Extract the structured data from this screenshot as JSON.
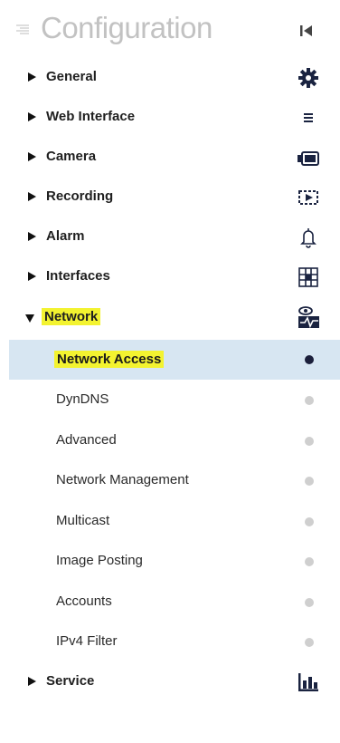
{
  "header": {
    "title": "Configuration",
    "menu_icon": "menu-lines-icon",
    "collapse_icon": "collapse-left-icon"
  },
  "nav": {
    "items": [
      {
        "label": "General",
        "icon": "gear-icon"
      },
      {
        "label": "Web Interface",
        "icon": "hamburger-icon"
      },
      {
        "label": "Camera",
        "icon": "camera-icon"
      },
      {
        "label": "Recording",
        "icon": "recording-icon"
      },
      {
        "label": "Alarm",
        "icon": "bell-icon"
      },
      {
        "label": "Interfaces",
        "icon": "interfaces-icon"
      },
      {
        "label": "Network",
        "icon": "network-monitor-icon",
        "expanded": true
      },
      {
        "label": "Service",
        "icon": "bar-chart-icon"
      }
    ],
    "network_subitems": [
      {
        "label": "Network Access",
        "active": true
      },
      {
        "label": "DynDNS"
      },
      {
        "label": "Advanced"
      },
      {
        "label": "Network Management"
      },
      {
        "label": "Multicast"
      },
      {
        "label": "Image Posting"
      },
      {
        "label": "Accounts"
      },
      {
        "label": "IPv4 Filter"
      }
    ]
  },
  "colors": {
    "highlight": "#f3f330",
    "active_row": "#d7e6f2",
    "active_dot": "#1b1f3b",
    "inactive_dot": "#cfcfcf",
    "title": "#c2c2c2"
  }
}
